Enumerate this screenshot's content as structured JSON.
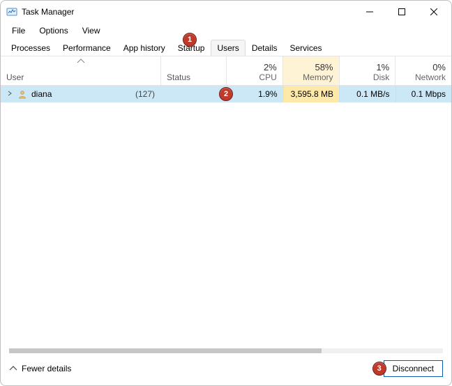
{
  "window": {
    "title": "Task Manager"
  },
  "menu": {
    "file": "File",
    "options": "Options",
    "view": "View"
  },
  "tabs": {
    "processes": "Processes",
    "performance": "Performance",
    "app_history": "App history",
    "startup": "Startup",
    "users": "Users",
    "details": "Details",
    "services": "Services"
  },
  "columns": {
    "user": "User",
    "status": "Status",
    "cpu_pct": "2%",
    "cpu_label": "CPU",
    "memory_pct": "58%",
    "memory_label": "Memory",
    "disk_pct": "1%",
    "disk_label": "Disk",
    "network_pct": "0%",
    "network_label": "Network"
  },
  "row": {
    "username": "diana",
    "process_count": "(127)",
    "status": "",
    "cpu": "1.9%",
    "memory": "3,595.8 MB",
    "disk": "0.1 MB/s",
    "network": "0.1 Mbps"
  },
  "footer": {
    "fewer": "Fewer details",
    "disconnect": "Disconnect"
  },
  "badges": {
    "b1": "1",
    "b2": "2",
    "b3": "3"
  }
}
